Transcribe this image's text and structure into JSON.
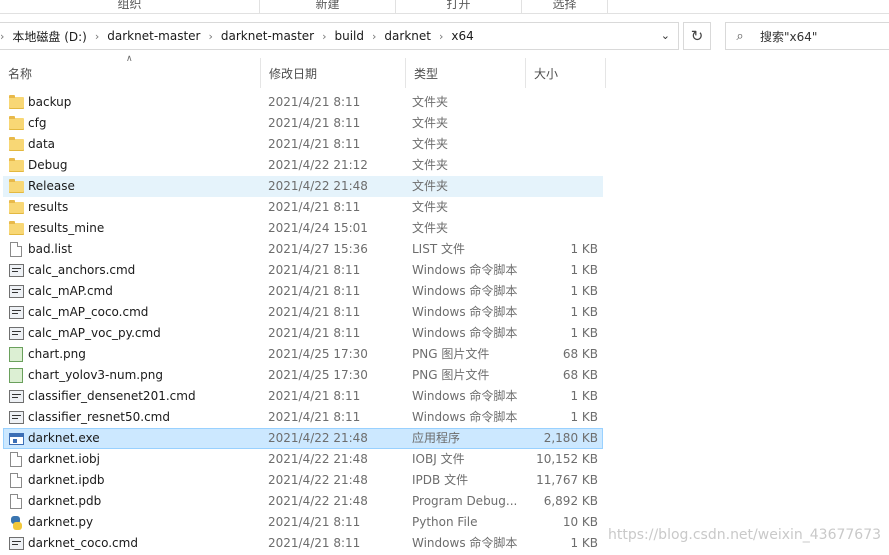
{
  "ribbon": {
    "groups": [
      "组织",
      "新建",
      "打开",
      "选择"
    ]
  },
  "address": {
    "crumbs": [
      "本地磁盘 (D:)",
      "darknet-master",
      "darknet-master",
      "build",
      "darknet",
      "x64"
    ],
    "separator": "›"
  },
  "search": {
    "placeholder": "搜索\"x64\""
  },
  "columns": {
    "name": "名称",
    "date": "修改日期",
    "type": "类型",
    "size": "大小"
  },
  "files": [
    {
      "name": "backup",
      "date": "2021/4/21 8:11",
      "type": "文件夹",
      "size": "",
      "icon": "folder-icon",
      "state": ""
    },
    {
      "name": "cfg",
      "date": "2021/4/21 8:11",
      "type": "文件夹",
      "size": "",
      "icon": "folder-icon",
      "state": ""
    },
    {
      "name": "data",
      "date": "2021/4/21 8:11",
      "type": "文件夹",
      "size": "",
      "icon": "folder-icon",
      "state": ""
    },
    {
      "name": "Debug",
      "date": "2021/4/22 21:12",
      "type": "文件夹",
      "size": "",
      "icon": "folder-icon",
      "state": ""
    },
    {
      "name": "Release",
      "date": "2021/4/22 21:48",
      "type": "文件夹",
      "size": "",
      "icon": "folder-icon",
      "state": "hover"
    },
    {
      "name": "results",
      "date": "2021/4/21 8:11",
      "type": "文件夹",
      "size": "",
      "icon": "folder-icon",
      "state": ""
    },
    {
      "name": "results_mine",
      "date": "2021/4/24 15:01",
      "type": "文件夹",
      "size": "",
      "icon": "folder-icon",
      "state": ""
    },
    {
      "name": "bad.list",
      "date": "2021/4/27 15:36",
      "type": "LIST 文件",
      "size": "1 KB",
      "icon": "file-icon",
      "state": ""
    },
    {
      "name": "calc_anchors.cmd",
      "date": "2021/4/21 8:11",
      "type": "Windows 命令脚本",
      "size": "1 KB",
      "icon": "cmd-script-icon",
      "state": ""
    },
    {
      "name": "calc_mAP.cmd",
      "date": "2021/4/21 8:11",
      "type": "Windows 命令脚本",
      "size": "1 KB",
      "icon": "cmd-script-icon",
      "state": ""
    },
    {
      "name": "calc_mAP_coco.cmd",
      "date": "2021/4/21 8:11",
      "type": "Windows 命令脚本",
      "size": "1 KB",
      "icon": "cmd-script-icon",
      "state": ""
    },
    {
      "name": "calc_mAP_voc_py.cmd",
      "date": "2021/4/21 8:11",
      "type": "Windows 命令脚本",
      "size": "1 KB",
      "icon": "cmd-script-icon",
      "state": ""
    },
    {
      "name": "chart.png",
      "date": "2021/4/25 17:30",
      "type": "PNG 图片文件",
      "size": "68 KB",
      "icon": "png-image-icon",
      "state": ""
    },
    {
      "name": "chart_yolov3-num.png",
      "date": "2021/4/25 17:30",
      "type": "PNG 图片文件",
      "size": "68 KB",
      "icon": "png-image-icon",
      "state": ""
    },
    {
      "name": "classifier_densenet201.cmd",
      "date": "2021/4/21 8:11",
      "type": "Windows 命令脚本",
      "size": "1 KB",
      "icon": "cmd-script-icon",
      "state": ""
    },
    {
      "name": "classifier_resnet50.cmd",
      "date": "2021/4/21 8:11",
      "type": "Windows 命令脚本",
      "size": "1 KB",
      "icon": "cmd-script-icon",
      "state": ""
    },
    {
      "name": "darknet.exe",
      "date": "2021/4/22 21:48",
      "type": "应用程序",
      "size": "2,180 KB",
      "icon": "application-icon",
      "state": "selected"
    },
    {
      "name": "darknet.iobj",
      "date": "2021/4/22 21:48",
      "type": "IOBJ 文件",
      "size": "10,152 KB",
      "icon": "file-icon",
      "state": ""
    },
    {
      "name": "darknet.ipdb",
      "date": "2021/4/22 21:48",
      "type": "IPDB 文件",
      "size": "11,767 KB",
      "icon": "file-icon",
      "state": ""
    },
    {
      "name": "darknet.pdb",
      "date": "2021/4/22 21:48",
      "type": "Program Debug...",
      "size": "6,892 KB",
      "icon": "file-icon",
      "state": ""
    },
    {
      "name": "darknet.py",
      "date": "2021/4/21 8:11",
      "type": "Python File",
      "size": "10 KB",
      "icon": "python-file-icon",
      "state": ""
    },
    {
      "name": "darknet_coco.cmd",
      "date": "2021/4/21 8:11",
      "type": "Windows 命令脚本",
      "size": "1 KB",
      "icon": "cmd-script-icon",
      "state": ""
    }
  ],
  "watermark": "https://blog.csdn.net/weixin_43677673"
}
